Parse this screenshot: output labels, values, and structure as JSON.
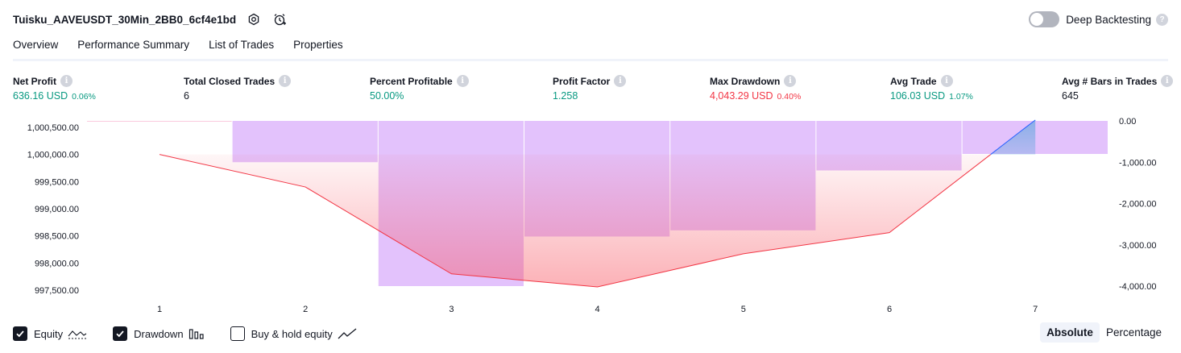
{
  "header": {
    "title": "Tuisku_AAVEUSDT_30Min_2BB0_6cf4e1bd",
    "deep_backtesting_label": "Deep Backtesting",
    "help_glyph": "?",
    "icons": [
      "settings-icon",
      "alert-clock-icon"
    ]
  },
  "tabs": [
    {
      "label": "Overview",
      "active": true
    },
    {
      "label": "Performance Summary",
      "active": false
    },
    {
      "label": "List of Trades",
      "active": false
    },
    {
      "label": "Properties",
      "active": false
    }
  ],
  "info_glyph": "i",
  "metrics": [
    {
      "label": "Net Profit",
      "value": "636.16 USD",
      "sub": "0.06%",
      "tone": "green"
    },
    {
      "label": "Total Closed Trades",
      "value": "6",
      "sub": "",
      "tone": "dark"
    },
    {
      "label": "Percent Profitable",
      "value": "50.00%",
      "sub": "",
      "tone": "green"
    },
    {
      "label": "Profit Factor",
      "value": "1.258",
      "sub": "",
      "tone": "green"
    },
    {
      "label": "Max Drawdown",
      "value": "4,043.29 USD",
      "sub": "0.40%",
      "tone": "red"
    },
    {
      "label": "Avg Trade",
      "value": "106.03 USD",
      "sub": "1.07%",
      "tone": "green"
    },
    {
      "label": "Avg # Bars in Trades",
      "value": "645",
      "sub": "",
      "tone": "dark"
    }
  ],
  "chart_data": {
    "type": "line",
    "x": [
      "1",
      "2",
      "3",
      "4",
      "5",
      "6",
      "7"
    ],
    "equity": [
      1000000,
      999400,
      997800,
      997560,
      998170,
      998560,
      1000636
    ],
    "drawdown": [
      0,
      -1000,
      -4000,
      -2800,
      -2650,
      -1200,
      -800
    ],
    "equity_axis": {
      "ticks": [
        "1,000,500.00",
        "1,000,000.00",
        "999,500.00",
        "999,000.00",
        "998,500.00",
        "998,000.00",
        "997,500.00"
      ],
      "tick_values": [
        1000500,
        1000000,
        999500,
        999000,
        998500,
        998000,
        997500
      ]
    },
    "drawdown_axis": {
      "ticks": [
        "0.00",
        "-1,000.00",
        "-2,000.00",
        "-3,000.00",
        "-4,000.00"
      ],
      "tick_values": [
        0,
        -1000,
        -2000,
        -3000,
        -4000
      ]
    },
    "colors": {
      "equity_loss_line": "#f23645",
      "equity_gain_line": "#2962ff",
      "drawdown_bar": "#e1bffc",
      "loss_fill": "#f7525f",
      "gain_fill": "#4fa3d9"
    }
  },
  "legend": [
    {
      "label": "Equity",
      "checked": true,
      "icon": "equity-line-icon"
    },
    {
      "label": "Drawdown",
      "checked": true,
      "icon": "drawdown-bars-icon"
    },
    {
      "label": "Buy & hold equity",
      "checked": false,
      "icon": "buy-hold-line-icon"
    }
  ],
  "view_modes": [
    {
      "label": "Absolute",
      "active": true
    },
    {
      "label": "Percentage",
      "active": false
    }
  ]
}
